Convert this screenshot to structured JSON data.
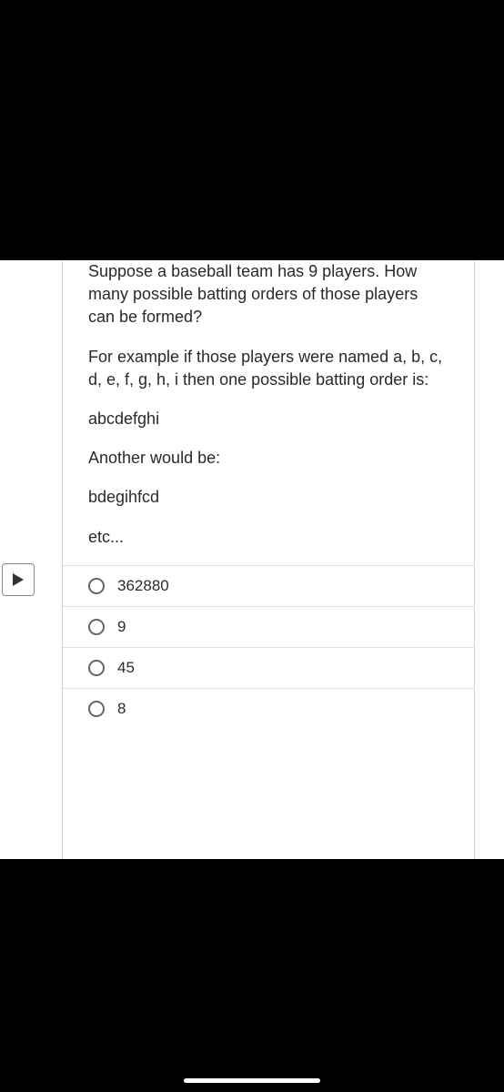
{
  "question": {
    "paragraphs": [
      "Suppose a baseball team has 9 players. How many possible batting orders of those players can be formed?",
      "For example if those players were named a, b, c, d, e, f, g, h, i then one possible batting order is:",
      "abcdefghi",
      "Another would be:",
      "bdegihfcd",
      "etc..."
    ]
  },
  "options": [
    {
      "label": "362880"
    },
    {
      "label": "9"
    },
    {
      "label": "45"
    },
    {
      "label": "8"
    }
  ]
}
